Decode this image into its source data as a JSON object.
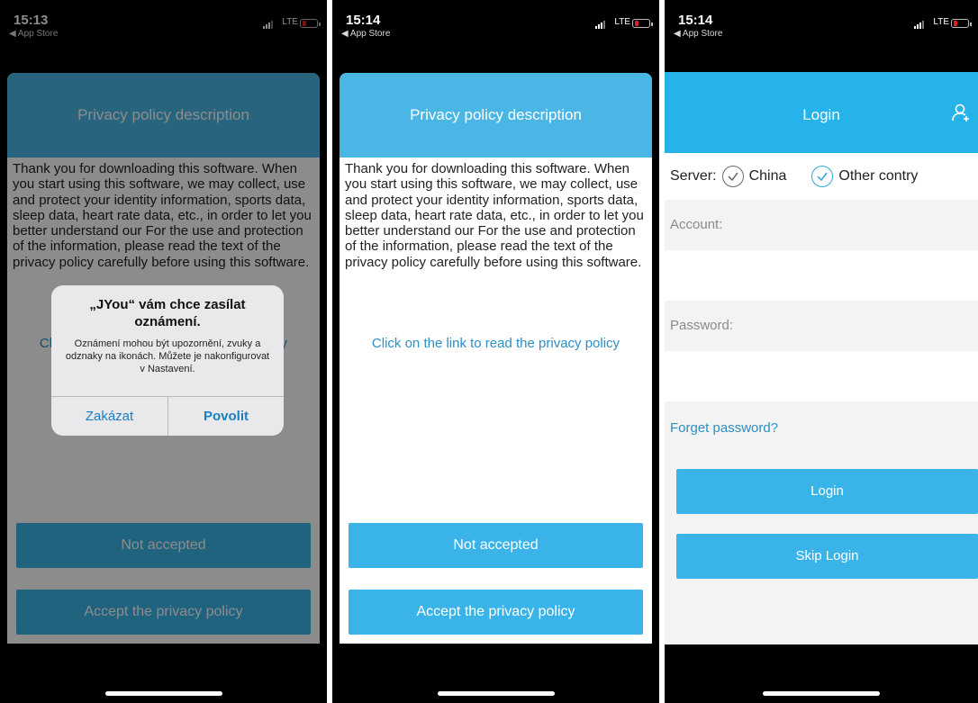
{
  "status_bars": [
    {
      "time": "15:13",
      "back": "◀ App Store",
      "network": "LTE"
    },
    {
      "time": "15:14",
      "back": "◀ App Store",
      "network": "LTE"
    },
    {
      "time": "15:14",
      "back": "◀ App Store",
      "network": "LTE"
    }
  ],
  "privacy": {
    "title": "Privacy policy description",
    "body": "Thank you for downloading this software. When you start using this software, we may collect, use and protect your identity information, sports data, sleep data, heart rate data, etc., in order to let you better understand our For the use and protection of the information, please read the text of the privacy policy carefully before using this software.",
    "link": "Click on the link to read the privacy policy",
    "not_accepted": "Not accepted",
    "accept": "Accept the privacy policy"
  },
  "alert": {
    "title": "„JYou“ vám chce zasílat oznámení.",
    "message": "Oznámení mohou být upozornění, zvuky a odznaky na ikonách. Můžete je nakonfigurovat v Nastavení.",
    "deny": "Zakázat",
    "allow": "Povolit"
  },
  "login": {
    "title": "Login",
    "server_label": "Server:",
    "server_options": [
      "China",
      "Other contry"
    ],
    "account_label": "Account:",
    "password_label": "Password:",
    "forget": "Forget password?",
    "login_button": "Login",
    "skip_button": "Skip Login"
  },
  "colors": {
    "header_blue": "#4ab6e6",
    "button_blue": "#3ab4e8",
    "link_blue": "#2c8fc4",
    "battery_red": "#e02020"
  },
  "icons": {
    "user_add": "add-user-icon",
    "check": "check-circle-icon"
  }
}
